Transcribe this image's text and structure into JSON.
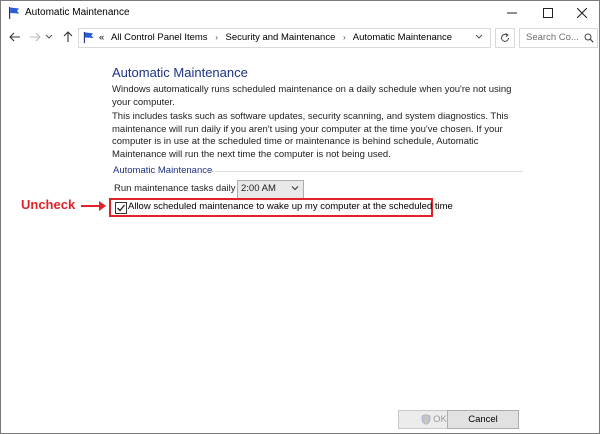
{
  "window": {
    "title": "Automatic Maintenance",
    "controls": {
      "minimize": "minimize-icon",
      "maximize": "maximize-icon",
      "close": "close-icon"
    }
  },
  "nav": {
    "back_icon": "arrow-left-icon",
    "forward_icon": "arrow-right-icon",
    "recent_icon": "chevron-down-icon",
    "up_icon": "arrow-up-icon",
    "address": {
      "prefix": "«",
      "crumbs": [
        "All Control Panel Items",
        "Security and Maintenance",
        "Automatic Maintenance"
      ],
      "separator": "›"
    },
    "refresh_icon": "refresh-icon",
    "search": {
      "placeholder": "Search Co...",
      "icon": "search-icon"
    }
  },
  "main": {
    "heading": "Automatic Maintenance",
    "para1": "Windows automatically runs scheduled maintenance on a daily schedule when you're not using your computer.",
    "para2": "This includes tasks such as software updates, security scanning, and system diagnostics. This maintenance will run daily if you aren't using your computer at the time you've chosen. If your computer is in use at the scheduled time or maintenance is behind schedule, Automatic Maintenance will run the next time the computer is not being used.",
    "group_label": "Automatic Maintenance",
    "run_label": "Run maintenance tasks daily at",
    "time_value": "2:00 AM",
    "wake_label": "Allow scheduled maintenance to wake up my computer at the scheduled time",
    "wake_checked": true
  },
  "annotation": {
    "text": "Uncheck",
    "color": "#e0232b"
  },
  "buttons": {
    "ok": "OK",
    "cancel": "Cancel"
  },
  "colors": {
    "heading": "#1e3287",
    "highlight": "#e0232b"
  }
}
